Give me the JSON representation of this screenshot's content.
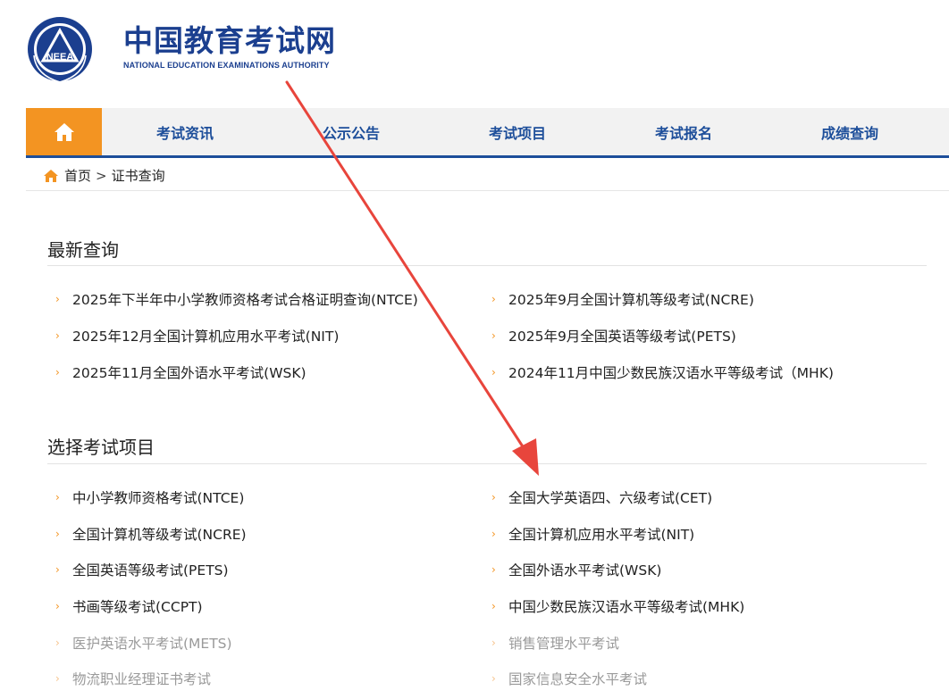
{
  "header": {
    "logo_cn": "中国教育考试网",
    "logo_en": "NATIONAL EDUCATION EXAMINATIONS AUTHORITY",
    "emblem_text": "NEEA"
  },
  "nav": {
    "home_icon": "home-icon",
    "items": [
      "考试资讯",
      "公示公告",
      "考试项目",
      "考试报名",
      "成绩查询"
    ]
  },
  "breadcrumb": {
    "home": "首页",
    "separator": ">",
    "current": "证书查询"
  },
  "latest": {
    "title": "最新查询",
    "items": [
      "2025年下半年中小学教师资格考试合格证明查询(NTCE)",
      "2025年9月全国计算机等级考试(NCRE)",
      "2025年12月全国计算机应用水平考试(NIT)",
      "2025年9月全国英语等级考试(PETS)",
      "2025年11月全国外语水平考试(WSK)",
      "2024年11月中国少数民族汉语水平等级考试（MHK)"
    ]
  },
  "select": {
    "title": "选择考试项目",
    "items": [
      "中小学教师资格考试(NTCE)",
      "全国大学英语四、六级考试(CET)",
      "全国计算机等级考试(NCRE)",
      "全国计算机应用水平考试(NIT)",
      "全国英语等级考试(PETS)",
      "全国外语水平考试(WSK)",
      "书画等级考试(CCPT)",
      "中国少数民族汉语水平等级考试(MHK)",
      "医护英语水平考试(METS)",
      "销售管理水平考试",
      "物流职业经理证书考试",
      "国家信息安全水平考试"
    ]
  },
  "colors": {
    "brand_blue": "#1d4e9a",
    "accent_orange": "#f39422",
    "annotation_arrow": "#e8453c"
  }
}
